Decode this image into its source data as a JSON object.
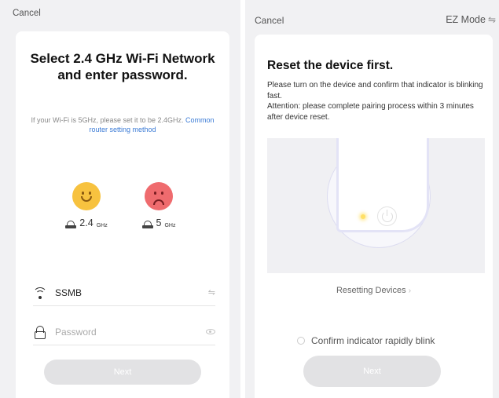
{
  "left": {
    "cancel": "Cancel",
    "title": "Select 2.4 GHz Wi-Fi Network and enter password.",
    "hint": "If your Wi-Fi is 5GHz, please set it to be 2.4GHz. ",
    "hint_link": "Common router setting method",
    "band_good": {
      "value": "2.4",
      "unit": "GHz",
      "icon": "happy-face-icon"
    },
    "band_bad": {
      "value": "5",
      "unit": "GHz",
      "icon": "sad-face-icon"
    },
    "ssid": {
      "value": "SSMB",
      "icon": "wifi-icon",
      "right_icon": "switch-icon"
    },
    "password": {
      "placeholder": "Password",
      "icon": "lock-icon",
      "right_icon": "eye-icon"
    },
    "next": "Next"
  },
  "right": {
    "cancel": "Cancel",
    "mode": "EZ Mode",
    "title": "Reset the device first.",
    "desc_1": "Please turn on the device and confirm that indicator is blinking fast.",
    "desc_2": "Attention: please complete pairing process within 3 minutes after device reset.",
    "resetting_link": "Resetting Devices",
    "confirm_label": "Confirm indicator rapidly blink",
    "next": "Next"
  },
  "colors": {
    "link": "#3b7bd6",
    "happy": "#f7c23f",
    "sad": "#ef6b6e",
    "button_disabled": "#e2e2e4",
    "led": "#ffe066"
  }
}
